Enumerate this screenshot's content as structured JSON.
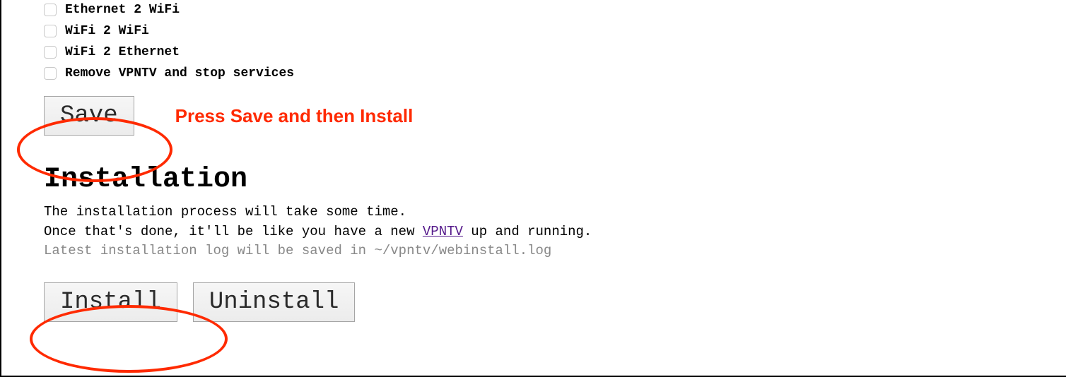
{
  "options": [
    {
      "label": "Ethernet 2 WiFi"
    },
    {
      "label": "WiFi 2 WiFi"
    },
    {
      "label": "WiFi 2 Ethernet"
    },
    {
      "label": "Remove VPNTV and stop services"
    }
  ],
  "save_button": "Save",
  "annotation": "Press Save and then Install",
  "installation_heading": "Installation",
  "desc_line1": "The installation process will take some time.",
  "desc_line2_pre": "Once that's done, it'll be like you have a new ",
  "desc_link": "VPNTV",
  "desc_line2_post": " up and running.",
  "log_line": "Latest installation log will be saved in ~/vpntv/webinstall.log",
  "install_button": "Install",
  "uninstall_button": "Uninstall"
}
